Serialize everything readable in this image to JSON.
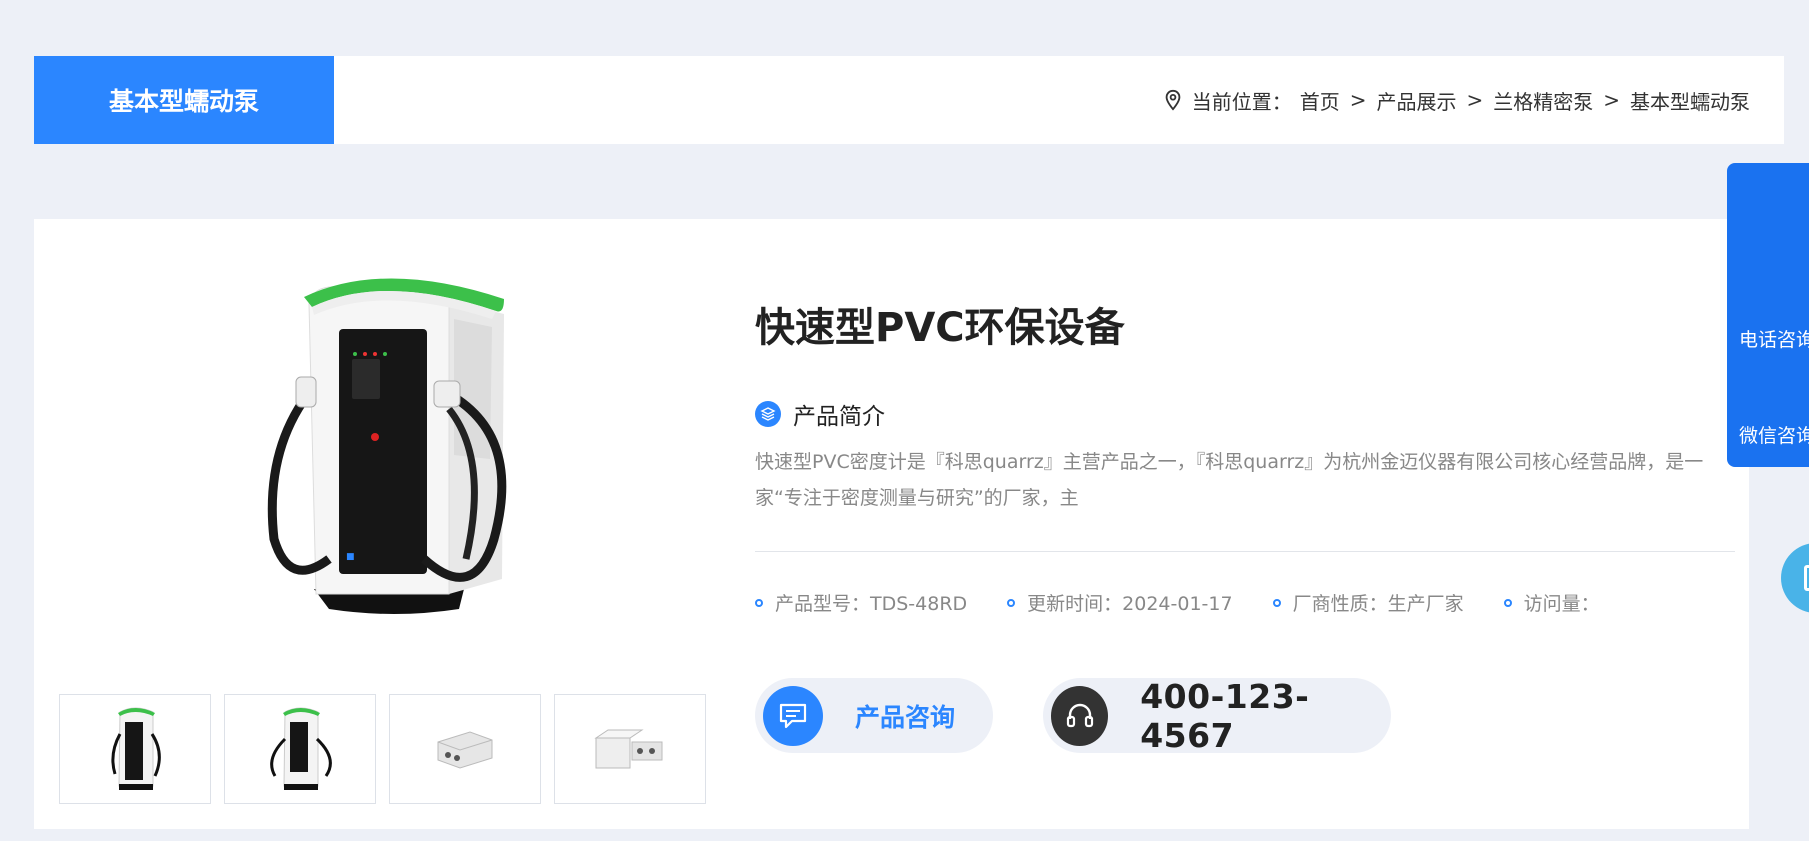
{
  "category": {
    "title": "基本型蠕动泵"
  },
  "breadcrumb": {
    "label": "当前位置：",
    "items": [
      "首页",
      "产品展示",
      "兰格精密泵",
      "基本型蠕动泵"
    ],
    "separator": ">"
  },
  "product": {
    "title": "快速型PVC环保设备",
    "intro_heading": "产品简介",
    "intro_text": "快速型PVC密度计是『科思quarrz』主营产品之一，『科思quarrz』为杭州金迈仪器有限公司核心经营品牌，是一家“专注于密度测量与研究”的厂家，主",
    "meta": [
      "产品型号：TDS-48RD",
      "更新时间：2024-01-17",
      "厂商性质：生产厂家",
      "访问量："
    ],
    "consult_label": "产品咨询",
    "phone": "400-123-4567"
  },
  "side_panel": {
    "phone_label": "电话咨询",
    "wechat_label": "微信咨询"
  },
  "colors": {
    "accent": "#2b86ff",
    "side_panel": "#1a72f0",
    "background": "#edf0f7"
  }
}
